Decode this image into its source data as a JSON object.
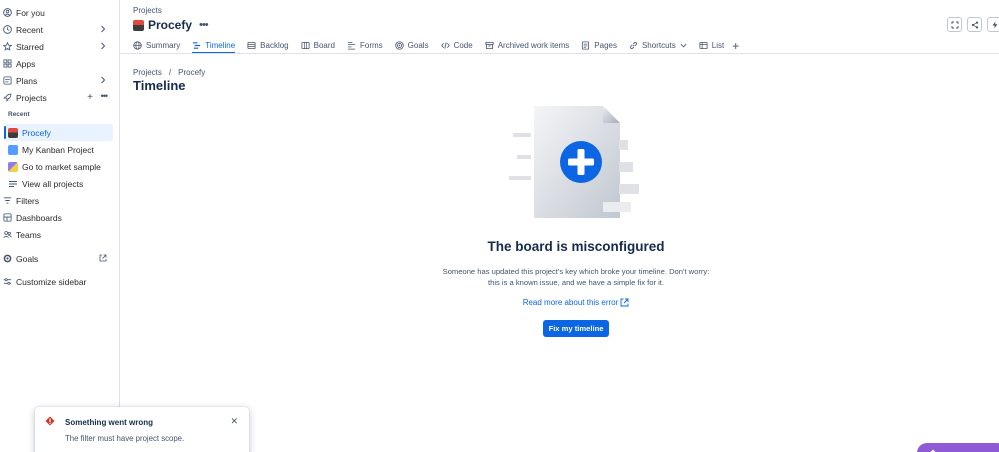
{
  "sidebar": {
    "for_you": "For you",
    "recent": "Recent",
    "starred": "Starred",
    "apps": "Apps",
    "plans": "Plans",
    "projects": "Projects",
    "recent_header": "Recent",
    "recent_projects": [
      {
        "label": "Procefy",
        "active": true
      },
      {
        "label": "My Kanban Project",
        "active": false
      },
      {
        "label": "Go to market sample",
        "active": false
      }
    ],
    "view_all": "View all projects",
    "filters": "Filters",
    "dashboards": "Dashboards",
    "teams": "Teams",
    "goals": "Goals",
    "customize": "Customize sidebar"
  },
  "header": {
    "breadcrumb": "Projects",
    "project_name": "Procefy"
  },
  "tabs": [
    {
      "label": "Summary",
      "icon": "globe-icon"
    },
    {
      "label": "Timeline",
      "icon": "timeline-icon",
      "active": true
    },
    {
      "label": "Backlog",
      "icon": "backlog-icon"
    },
    {
      "label": "Board",
      "icon": "board-icon"
    },
    {
      "label": "Forms",
      "icon": "forms-icon"
    },
    {
      "label": "Goals",
      "icon": "goals-icon"
    },
    {
      "label": "Code",
      "icon": "code-icon"
    },
    {
      "label": "Archived work items",
      "icon": "archive-icon"
    },
    {
      "label": "Pages",
      "icon": "pages-icon"
    },
    {
      "label": "Shortcuts",
      "icon": "link-icon"
    },
    {
      "label": "List",
      "icon": "list-icon"
    }
  ],
  "page": {
    "crumb_projects": "Projects",
    "crumb_sep": "/",
    "crumb_project": "Procefy",
    "title": "Timeline"
  },
  "empty_state": {
    "title": "The board is misconfigured",
    "description": "Someone has updated this project's key which broke your timeline. Don't worry: this is a known issue, and we have a simple fix for it.",
    "read_more": "Read more about this error",
    "fix_button": "Fix my timeline"
  },
  "toast": {
    "title": "Something went wrong",
    "body": "The filter must have project scope."
  },
  "colors": {
    "accent": "#0c66e4",
    "error": "#c9372c",
    "rovo": "#8f5ad6"
  }
}
